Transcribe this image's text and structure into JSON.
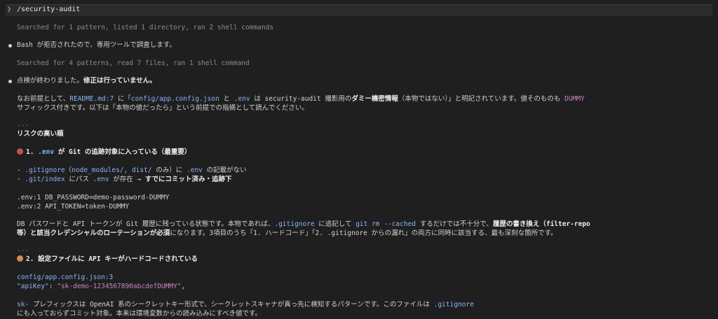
{
  "prompt": {
    "chevron": "❯",
    "command": "/security-audit"
  },
  "blocks": {
    "search1": "Searched for 1 pattern, listed 1 directory, ran 2 shell commands",
    "bash_msg": "Bash が拒否されたので、専用ツールで調査します。",
    "search2": "Searched for 4 patterns, read 7 files, ran 1 shell command",
    "done_msg_a": "点検が終わりました。",
    "done_msg_b": "修正は行っていません。",
    "note_l1_a": "なお前提として、",
    "note_l1_b": "README.md:7",
    "note_l1_c": " に「",
    "note_l1_d": "config/app.config.json",
    "note_l1_e": " と ",
    "note_l1_f": ".env",
    "note_l1_g": " は security-audit 撮影用の",
    "note_l1_h": "ダミー機密情報",
    "note_l1_i": "（本物ではない）」と明記されています。値そのものも ",
    "note_l1_j": "DUMMY",
    "note_l2": "サフィックス付きです。以下は「本物の値だったら」という前提での指摘として読んでください。",
    "sep1": "---",
    "risk_heading": "リスクの高い順",
    "item1_title_a": "1. ",
    "item1_title_b": ".env",
    "item1_title_c": " が Git の追跡対象に入っている（最重要）",
    "item1_li1_a": "- ",
    "item1_li1_b": ".gitignore",
    "item1_li1_c": "（",
    "item1_li1_d": "node_modules/, dist/",
    "item1_li1_e": " のみ）に ",
    "item1_li1_f": ".env",
    "item1_li1_g": " の記載がない",
    "item1_li2_a": "- ",
    "item1_li2_b": ".git/index",
    "item1_li2_c": " にパス ",
    "item1_li2_d": ".env",
    "item1_li2_e": " が存在 → ",
    "item1_li2_f": "すでにコミット済み・追跡下",
    "env_line1": ".env:1  DB_PASSWORD=demo-password-DUMMY",
    "env_line2": ".env:2  API_TOKEN=token-DUMMY",
    "item1_p1_a": "DB パスワードと API トークンが Git 履歴に残っている状態です。本物であれば、",
    "item1_p1_b": ".gitignore",
    "item1_p1_c": " に追記して ",
    "item1_p1_d": "git rm --cached",
    "item1_p1_e": " するだけでは不十分で、",
    "item1_p1_f": "履歴の書き換え（filter-repo",
    "item1_p2_a": "等）と該当クレデンシャルのローテーションが必須",
    "item1_p2_b": "になります。3項目のうち「1. ハードコード」「2. ",
    "item1_p2_c": ".gitignore",
    "item1_p2_d": " からの漏れ」の両方に同時に該当する、最も深刻な箇所です。",
    "sep2": "---",
    "item2_title": "2. 設定ファイルに API キーがハードコードされている",
    "item2_ref": "config/app.config.json:3",
    "item2_json_key": "\"apiKey\"",
    "item2_json_colon": ": ",
    "item2_json_val": "\"sk-demo-1234567890abcdefDUMMY\"",
    "item2_json_comma": ",",
    "item2_p1_a": "sk-",
    "item2_p1_b": " プレフィックスは OpenAI 系のシークレットキー形式で、シークレットスキャナが真っ先に検知するパターンです。このファイルは ",
    "item2_p1_c": ".gitignore",
    "item2_p2": "にも入っておらずコミット対象。本来は環境変数からの読み込みにすべき値です。"
  }
}
